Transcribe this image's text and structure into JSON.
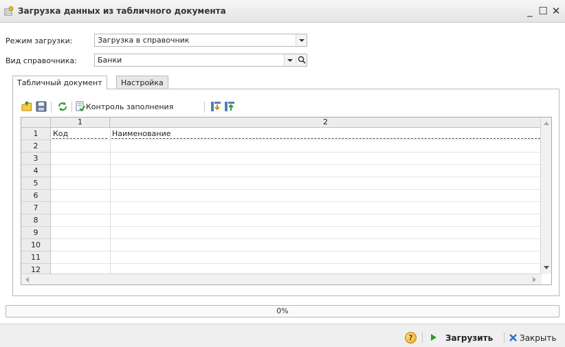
{
  "window": {
    "title": "Загрузка данных из табличного документа",
    "minimize": "_",
    "maximize": "☐",
    "close": "✕"
  },
  "form": {
    "mode_label": "Режим загрузки:",
    "mode_value": "Загрузка в справочник",
    "catalog_label": "Вид справочника:",
    "catalog_value": "Банки"
  },
  "tabs": [
    {
      "label": "Табличный документ",
      "active": true
    },
    {
      "label": "Настройка",
      "active": false
    }
  ],
  "toolbar": {
    "fill_check_label": "Контроль заполнения"
  },
  "grid": {
    "columns": [
      "1",
      "2"
    ],
    "header_cells": [
      "Код",
      "Наименование"
    ],
    "rows": [
      "1",
      "2",
      "3",
      "4",
      "5",
      "6",
      "7",
      "8",
      "9",
      "10",
      "11",
      "12"
    ]
  },
  "progress": {
    "text": "0%",
    "value": 0
  },
  "footer": {
    "help_icon": "?",
    "load_label": "Загрузить",
    "close_label": "Закрыть"
  },
  "colors": {
    "accent_green": "#2e9b2e",
    "close_red": "#2d6ec2",
    "help_yellow": "#e8a31a"
  }
}
